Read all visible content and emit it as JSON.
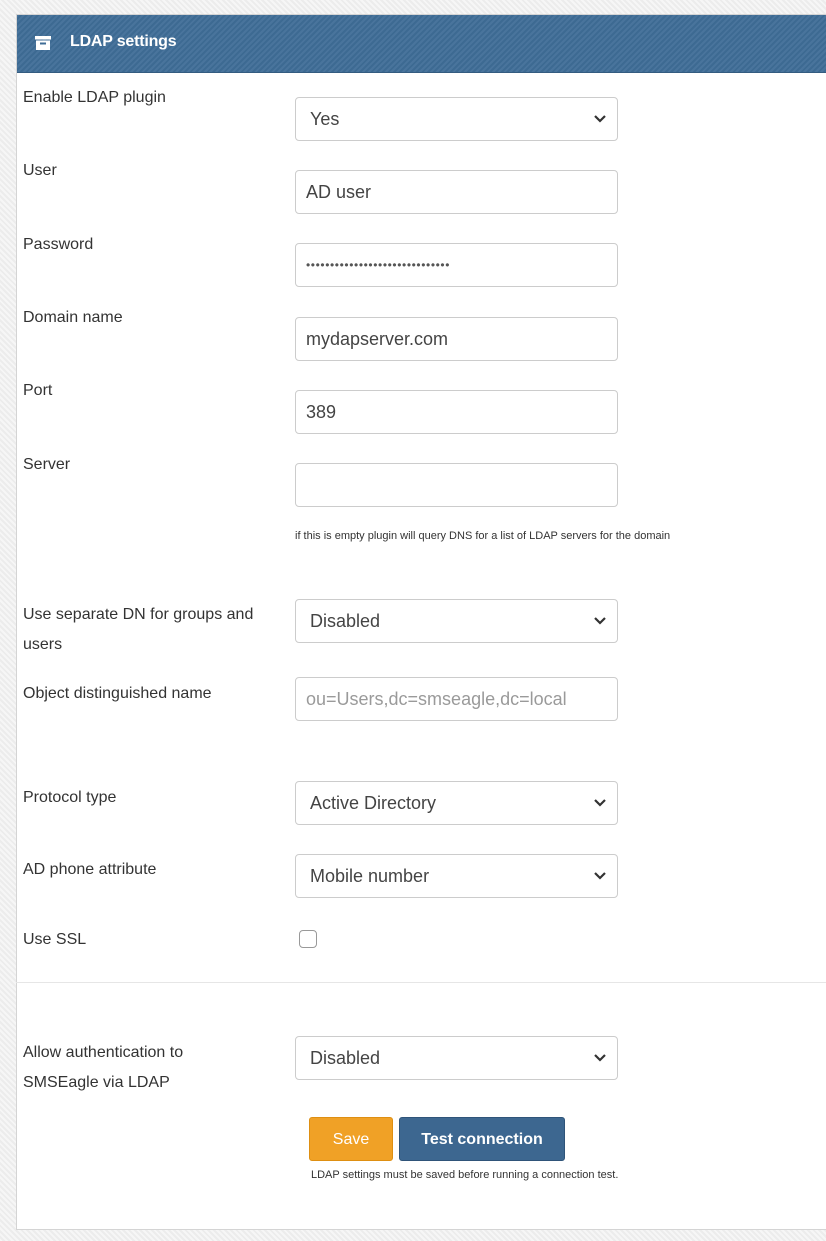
{
  "header": {
    "title": "LDAP settings",
    "icon": "archive-icon"
  },
  "fields": [
    {
      "label": "Enable LDAP plugin",
      "type": "select",
      "value": "Yes"
    },
    {
      "label": "User",
      "type": "text",
      "value": "AD user"
    },
    {
      "label": "Password",
      "type": "password",
      "value": "••••••••••••••••••••••••••••••"
    },
    {
      "label": "Domain name",
      "type": "text",
      "value": "mydapserver.com"
    },
    {
      "label": "Port",
      "type": "text",
      "value": "389"
    },
    {
      "label": "Server",
      "type": "text",
      "value": "",
      "help": "if this is empty plugin will query DNS for a list of LDAP servers for the domain"
    },
    {
      "label_line1": "Use separate DN for groups and",
      "label_line2": "users",
      "type": "select",
      "value": "Disabled"
    },
    {
      "label": "Object distinguished name",
      "type": "text",
      "value": "",
      "placeholder": "ou=Users,dc=smseagle,dc=local"
    },
    {
      "label": "Protocol type",
      "type": "select",
      "value": "Active Directory"
    },
    {
      "label": "AD phone attribute",
      "type": "select",
      "value": "Mobile number"
    },
    {
      "label": "Use SSL",
      "type": "checkbox",
      "checked": false
    },
    {
      "label_line1": "Allow authentication to",
      "label_line2": "SMSEagle via LDAP",
      "type": "select",
      "value": "Disabled"
    }
  ],
  "buttons": {
    "save": "Save",
    "test": "Test connection"
  },
  "note": "LDAP settings must be saved before running a connection test.",
  "colors": {
    "header": "#3f6d97",
    "save": "#f0a126",
    "test": "#3d6790"
  }
}
